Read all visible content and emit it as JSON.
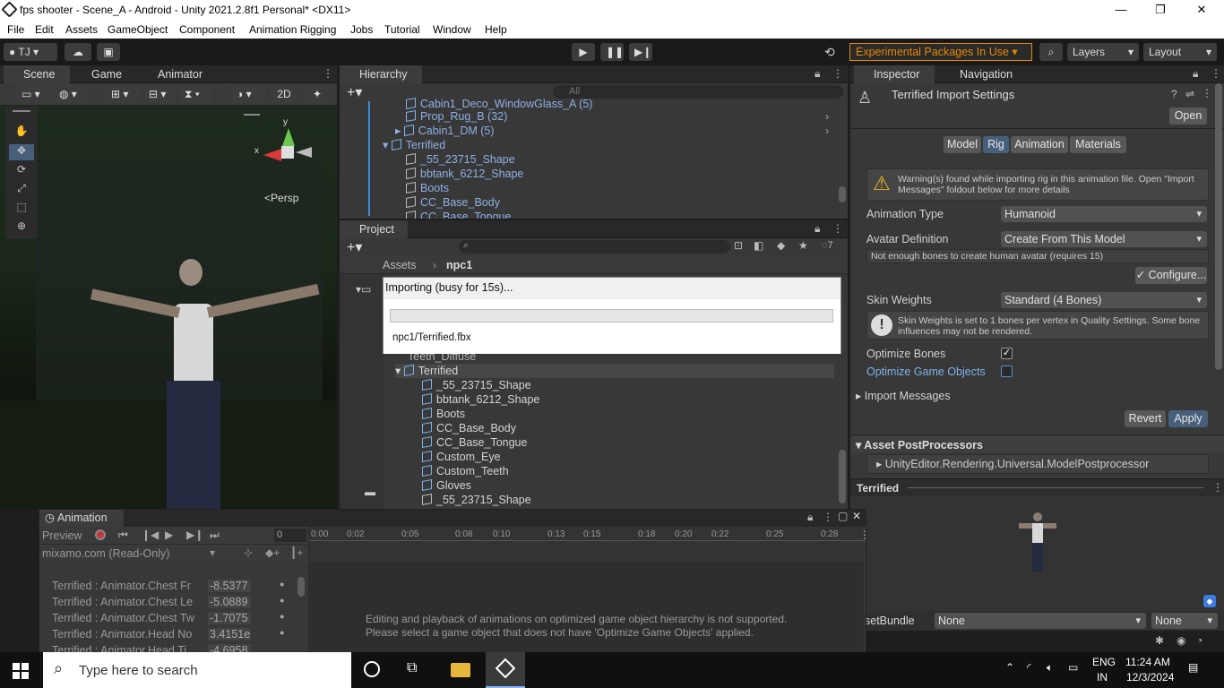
{
  "window": {
    "title": "fps shooter - Scene_A - Android - Unity 2021.2.8f1 Personal* <DX11>",
    "minimize": "—",
    "maximize": "❐",
    "close": "✕"
  },
  "menu": [
    "File",
    "Edit",
    "Assets",
    "GameObject",
    "Component",
    "Animation Rigging",
    "Jobs",
    "Tutorial",
    "Window",
    "Help"
  ],
  "toolbar": {
    "account": "TJ",
    "experimental": "Experimental Packages In Use",
    "layers": "Layers",
    "layout": "Layout"
  },
  "scene": {
    "tabs": [
      "Scene",
      "Game",
      "Animator"
    ],
    "mode2d": "2D",
    "persp": "Persp",
    "axis_x": "x",
    "axis_y": "y"
  },
  "hierarchy": {
    "tab": "Hierarchy",
    "search_placeholder": "All",
    "rows": [
      "Cabin1_Deco_WindowGlass_A (5)",
      "Prop_Rug_B (32)",
      "Cabin1_DM (5)",
      "Terrified",
      "_55_23715_Shape",
      "bbtank_6212_Shape",
      "Boots",
      "CC_Base_Body",
      "CC_Base_Tongue"
    ]
  },
  "project": {
    "tab": "Project",
    "crumb_root": "Assets",
    "crumb_child": "npc1",
    "hidden_count": "7",
    "rows": [
      "Teeth_Diffuse",
      "Terrified",
      "_55_23715_Shape",
      "bbtank_6212_Shape",
      "Boots",
      "CC_Base_Body",
      "CC_Base_Tongue",
      "Custom_Eye",
      "Custom_Teeth",
      "Gloves",
      "_55_23715_Shape"
    ]
  },
  "importing": {
    "title": "Importing (busy for 15s)...",
    "file": "npc1/Terrified.fbx",
    "progress": 0.0
  },
  "inspector": {
    "tabs": [
      "Inspector",
      "Navigation"
    ],
    "title": "Terrified Import Settings",
    "open": "Open",
    "subtabs": [
      "Model",
      "Rig",
      "Animation",
      "Materials"
    ],
    "warning": "Warning(s) found while importing rig in this animation file. Open \"Import Messages\" foldout below for more details",
    "animation_type_label": "Animation Type",
    "animation_type": "Humanoid",
    "avatar_def_label": "Avatar Definition",
    "avatar_def": "Create From This Model",
    "avatar_note": "Not enough bones to create human avatar (requires 15)",
    "configure": "Configure...",
    "skin_label": "Skin Weights",
    "skin": "Standard (4 Bones)",
    "skin_info": "Skin Weights is set to 1 bones per vertex in Quality Settings. Some bone influences may not be rendered.",
    "opt_bones": "Optimize Bones",
    "opt_go": "Optimize Game Objects",
    "import_messages": "Import Messages",
    "revert": "Revert",
    "apply": "Apply",
    "postproc_header": "Asset PostProcessors",
    "postproc_item": "UnityEditor.Rendering.Universal.ModelPostprocessor",
    "preview_title": "Terrified",
    "assetbundle_label": "setBundle",
    "assetbundle": "None",
    "variant": "None"
  },
  "animation": {
    "tab": "Animation",
    "preview": "Preview",
    "frame": "0",
    "clip": "mixamo.com (Read-Only)",
    "ticks": [
      "0:00",
      "0:02",
      "0:05",
      "0:08",
      "0:10",
      "0:13",
      "0:15",
      "0:18",
      "0:20",
      "0:22",
      "0:25",
      "0:28"
    ],
    "props": [
      {
        "name": "Terrified : Animator.Chest Fr",
        "value": "-8.5377"
      },
      {
        "name": "Terrified : Animator.Chest Le",
        "value": "-5.0889"
      },
      {
        "name": "Terrified : Animator.Chest Tw",
        "value": "-1.7075"
      },
      {
        "name": "Terrified : Animator.Head No",
        "value": "3.4151e"
      },
      {
        "name": "Terrified : Animator.Head Ti",
        "value": "-4.6958"
      }
    ],
    "msg1": "Editing and playback of animations on optimized game object hierarchy is not supported.",
    "msg2": "Please select a game object that does not have 'Optimize Game Objects' applied."
  },
  "taskbar": {
    "search": "Type here to search",
    "lang1": "ENG",
    "lang2": "IN",
    "time": "11:24 AM",
    "date": "12/3/2024"
  }
}
